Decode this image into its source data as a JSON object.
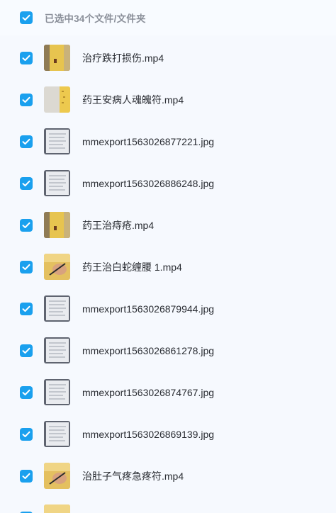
{
  "header": {
    "selection_label": "已选中34个文件/文件夹"
  },
  "files": [
    {
      "name": "治疗跌打损伤.mp4",
      "thumb": "video-yellow"
    },
    {
      "name": "药王安病人魂魄符.mp4",
      "thumb": "video-paper"
    },
    {
      "name": "mmexport1563026877221.jpg",
      "thumb": "doc-photo"
    },
    {
      "name": "mmexport1563026886248.jpg",
      "thumb": "doc-photo"
    },
    {
      "name": "药王治痔疮.mp4",
      "thumb": "video-yellow"
    },
    {
      "name": "药王治白蛇缠腰 1.mp4",
      "thumb": "video-hand"
    },
    {
      "name": "mmexport1563026879944.jpg",
      "thumb": "doc-photo"
    },
    {
      "name": "mmexport1563026861278.jpg",
      "thumb": "doc-photo"
    },
    {
      "name": "mmexport1563026874767.jpg",
      "thumb": "doc-photo"
    },
    {
      "name": "mmexport1563026869139.jpg",
      "thumb": "doc-photo"
    },
    {
      "name": "治肚子气疼急疼符.mp4",
      "thumb": "video-hand"
    },
    {
      "name": "",
      "thumb": "video-hand"
    }
  ],
  "colors": {
    "accent": "#1aa0ee",
    "background": "#f6f9fe",
    "header_text": "#8a8f99",
    "item_text": "#2a2d33"
  }
}
